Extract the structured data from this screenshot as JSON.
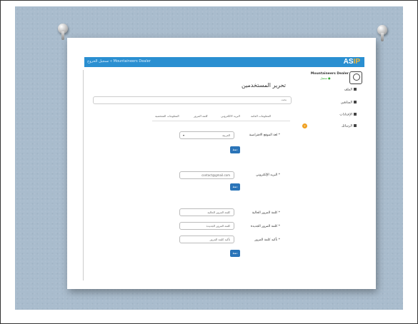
{
  "topbar": {
    "left_link": "تسجيل الخروج",
    "left_link2": "« Mountaineers Dealer",
    "logo_main": "AS",
    "logo_accent": "IP"
  },
  "user": {
    "name": "Mountaineers Dealer",
    "status": "متصل ●"
  },
  "sidebar": {
    "items": [
      {
        "label": "الملف",
        "icon": "user-icon"
      },
      {
        "label": "المتابعين",
        "icon": "users-icon"
      },
      {
        "label": "الإعدادات",
        "icon": "gear-icon"
      },
      {
        "label": "الرسائل",
        "icon": "mail-icon"
      }
    ],
    "badge": "٣"
  },
  "page": {
    "title": "تحرير المستخدمين",
    "search_text": "بحث"
  },
  "tabs": [
    "المعلومات الشخصية",
    "كلمة المرور",
    "البريد الالكتروني",
    "المعلومات العامة"
  ],
  "form": {
    "section1": {
      "label": "لغة الموقع الافتراضية *",
      "value": "العربية",
      "caret": "▾",
      "button": "حفظ"
    },
    "section2": {
      "label": "البريد الإلكتروني *",
      "value": "contact@gmail.com",
      "button": "حفظ"
    },
    "section3": {
      "fields": [
        {
          "label": "كلمة المرور الحالية *",
          "placeholder": "كلمة المرور الحالية"
        },
        {
          "label": "كلمة المرور الجديدة *",
          "placeholder": "كلمة المرور الجديدة"
        },
        {
          "label": "تأكيد كلمة المرور *",
          "placeholder": "تأكيد كلمة المرور"
        }
      ],
      "button": "حفظ"
    }
  },
  "colors": {
    "topbar": "#2a8fd1",
    "button": "#2a74b8",
    "board": "#a9bccd",
    "badge": "#f0a020"
  }
}
